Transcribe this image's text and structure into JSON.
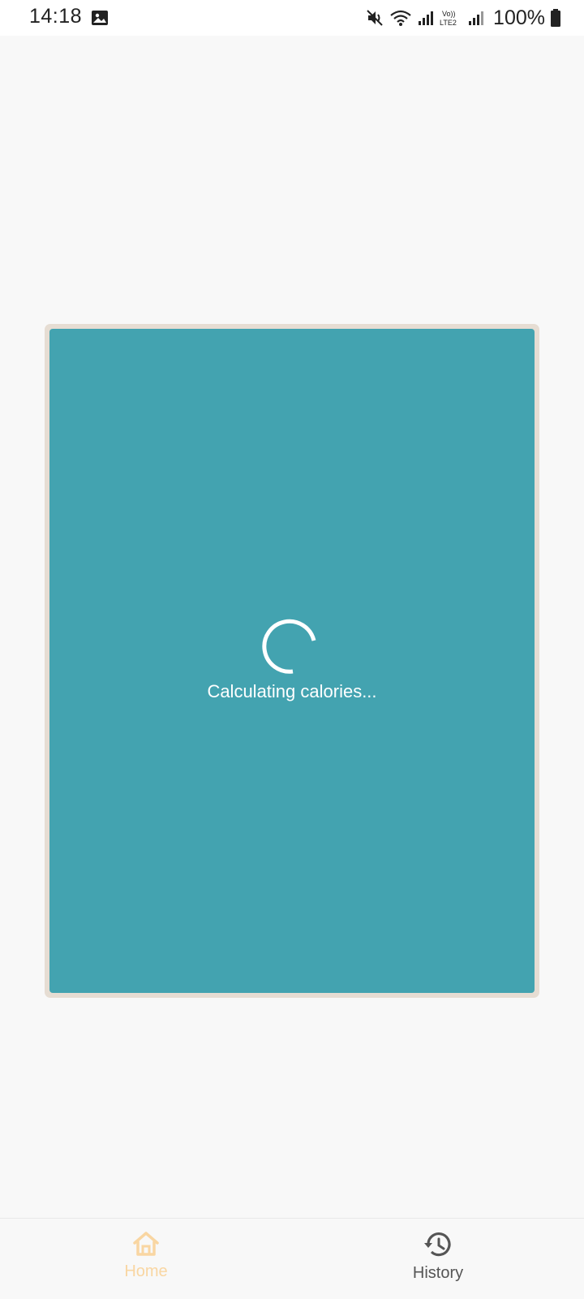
{
  "status_bar": {
    "time": "14:18",
    "battery": "100%",
    "icons": [
      "gallery-icon",
      "mute-icon",
      "wifi-icon",
      "signal-icon",
      "volte-icon",
      "signal-icon",
      "battery-icon"
    ]
  },
  "loading": {
    "text": "Calculating calories..."
  },
  "bottom_nav": {
    "items": [
      {
        "label": "Home",
        "icon": "home-icon",
        "active": true
      },
      {
        "label": "History",
        "icon": "history-icon",
        "active": false
      }
    ]
  },
  "colors": {
    "card": "#43a3b0",
    "card_border": "#e6ddd3",
    "active_tab": "#f9d6a2",
    "inactive_tab": "#555555",
    "background": "#f8f8f8"
  }
}
